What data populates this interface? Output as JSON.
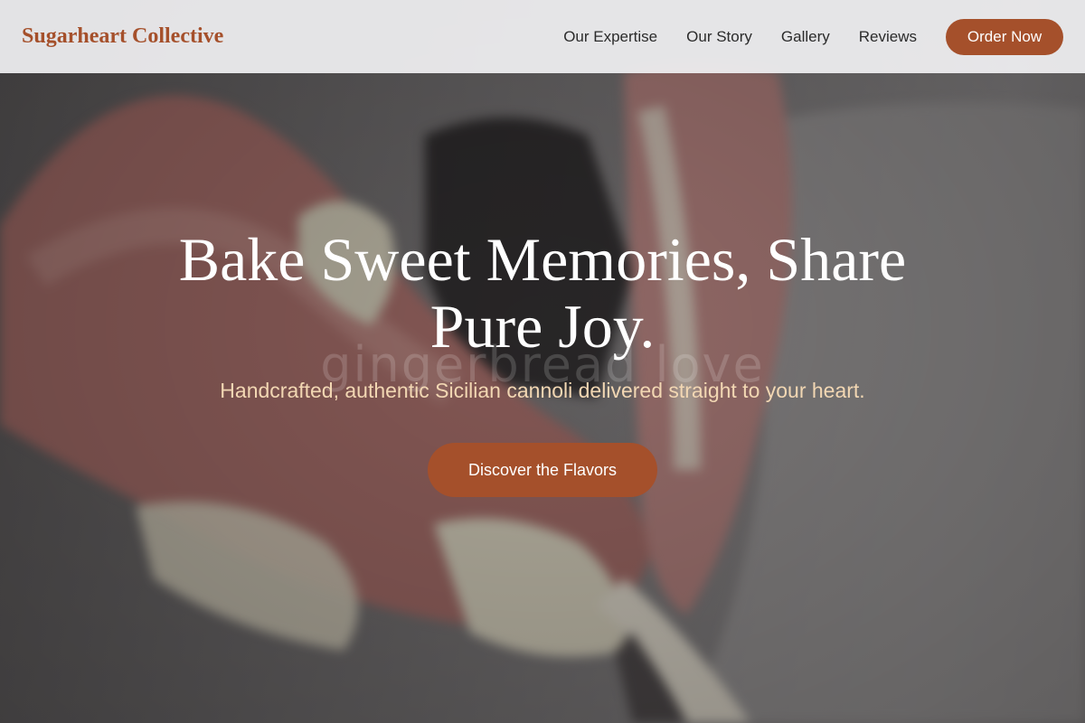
{
  "nav": {
    "brand": "Sugarheart Collective",
    "links": [
      "Our Expertise",
      "Our Story",
      "Gallery",
      "Reviews"
    ],
    "cta": "Order Now"
  },
  "hero": {
    "title": "Bake Sweet Memories, Share Pure Joy.",
    "watermark": "gingerbread love",
    "subtitle": "Handcrafted, authentic Sicilian cannoli delivered straight to your heart.",
    "cta": "Discover the Flavors"
  },
  "colors": {
    "accent": "#a5502b",
    "subtitle": "#f2d7b3",
    "nav_bg": "#f0f0f2",
    "nav_text": "#2b2b2b"
  }
}
